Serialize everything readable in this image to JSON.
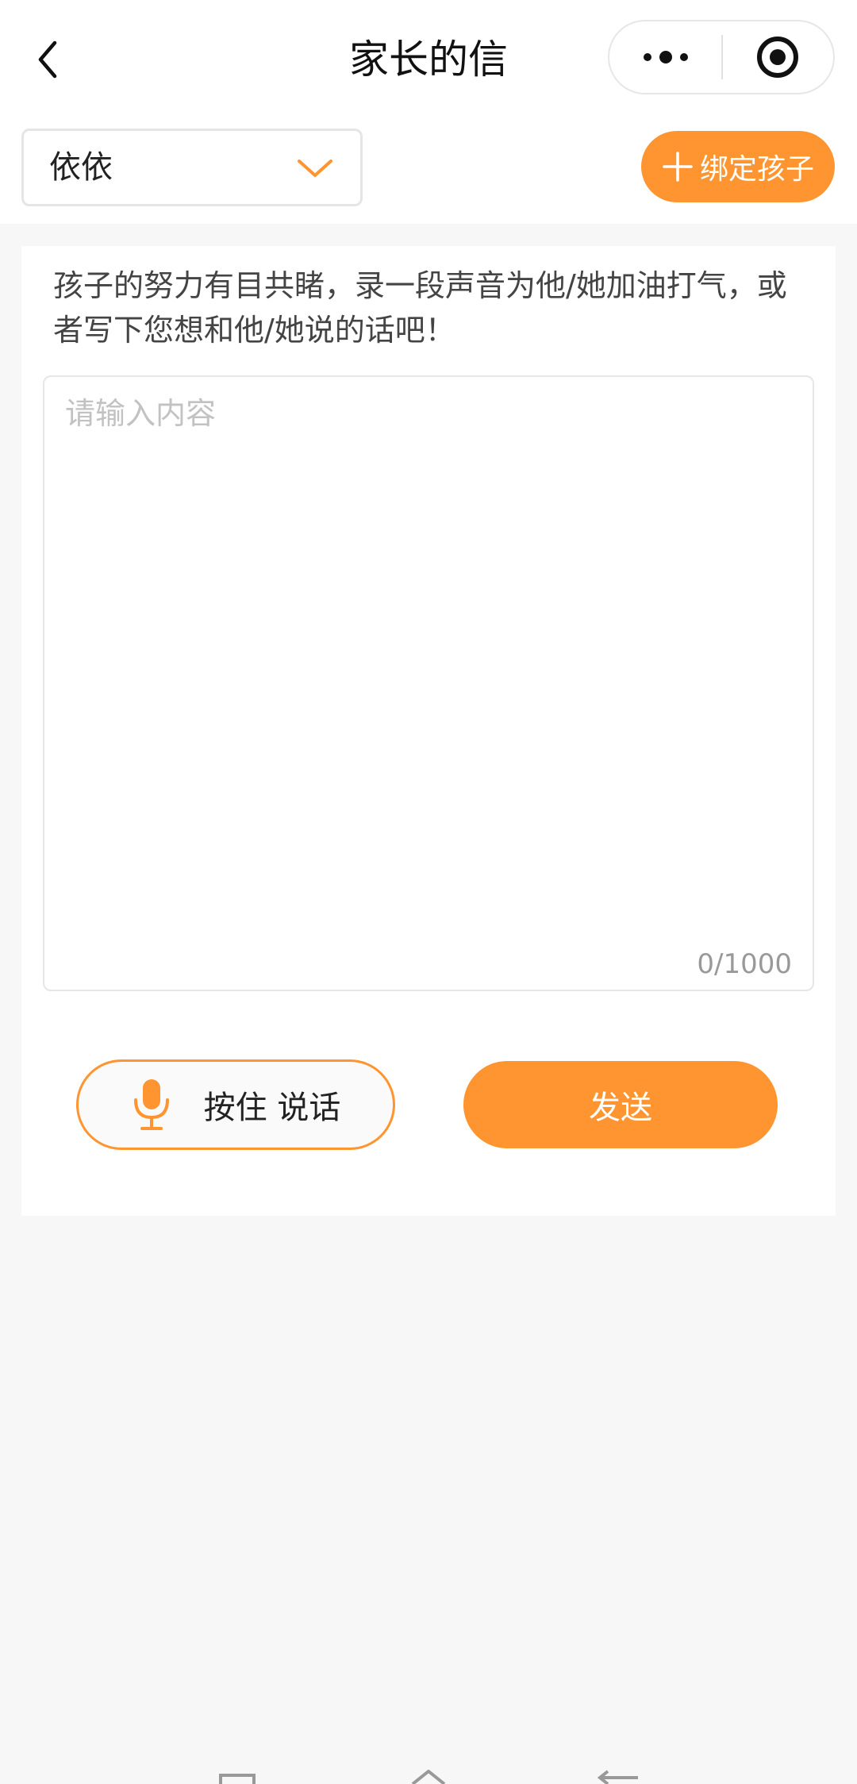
{
  "header": {
    "title": "家长的信",
    "back_icon": "chevron-left-icon",
    "more_icon": "more-dots-icon",
    "close_icon": "target-circle-icon"
  },
  "toolbar": {
    "selected_child": "依依",
    "dropdown_icon": "chevron-down-icon",
    "bind_label": "绑定孩子",
    "bind_icon": "plus-icon"
  },
  "message": {
    "hint": "孩子的努力有目共睹，录一段声音为他/她加油打气，或者写下您想和他/她说的话吧！",
    "value": "",
    "placeholder": "请输入内容",
    "counter": "0/1000"
  },
  "actions": {
    "voice_label": "按住 说话",
    "voice_icon": "microphone-icon",
    "send_label": "发送"
  },
  "colors": {
    "accent": "#ff9530",
    "background": "#f7f7f7",
    "placeholder": "#c2c2c2"
  }
}
